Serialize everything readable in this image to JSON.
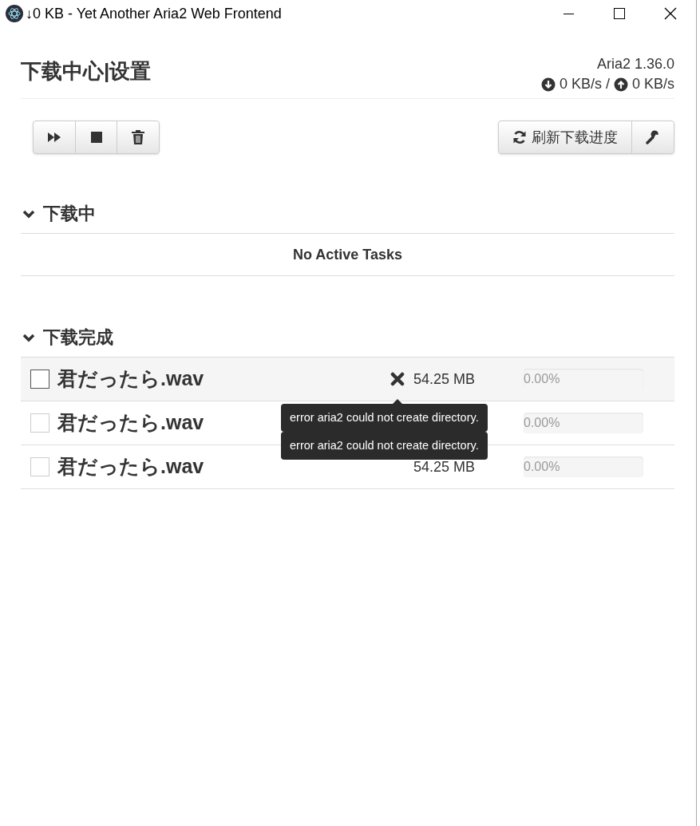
{
  "window": {
    "title": "↓0 KB - Yet Another Aria2 Web Frontend"
  },
  "header": {
    "title": "下载中心|设置",
    "version": "Aria2 1.36.0",
    "download_speed": "0 KB/s",
    "separator": "/",
    "upload_speed": "0 KB/s"
  },
  "toolbar": {
    "refresh_label": "刷新下载进度"
  },
  "sections": [
    {
      "title": "下载中",
      "expanded": true,
      "empty_text": "No Active Tasks"
    },
    {
      "title": "下载完成",
      "expanded": true,
      "tasks": [
        {
          "name": "君だったら.wav",
          "size": "54.25 MB",
          "checked": false,
          "highlighted": true,
          "progress_text": "0.00%",
          "level": 0,
          "error": "error aria2 could not create directory.",
          "tooltip_shown": true
        },
        {
          "name": "君だったら.wav",
          "checked": false,
          "highlighted": false,
          "progress_text": "0.00%",
          "level": 0,
          "error": "error aria2 could not create directory.",
          "tooltip_shown": true
        },
        {
          "name": "君だったら.wav",
          "size": "54.25 MB",
          "checked": false,
          "highlighted": false,
          "progress_text": "0.00%",
          "level": 0
        }
      ]
    }
  ]
}
